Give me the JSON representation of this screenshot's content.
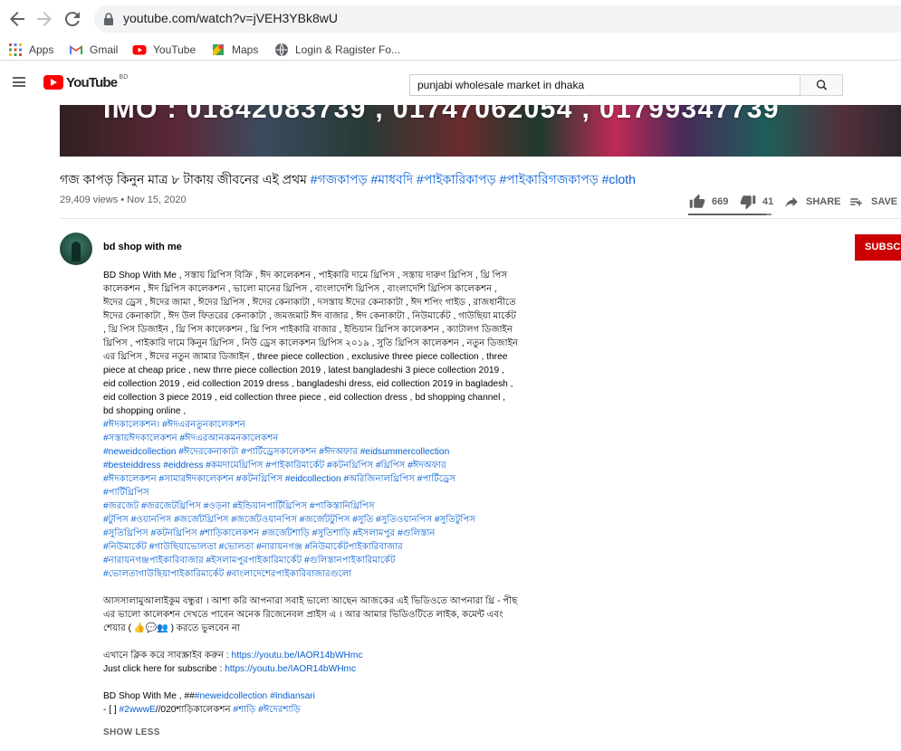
{
  "browser": {
    "url": "youtube.com/watch?v=jVEH3YBk8wU",
    "bookmarks": [
      {
        "label": "Apps",
        "icon": "apps-grid-icon"
      },
      {
        "label": "Gmail",
        "icon": "gmail-icon"
      },
      {
        "label": "YouTube",
        "icon": "youtube-icon"
      },
      {
        "label": "Maps",
        "icon": "maps-icon"
      },
      {
        "label": "Login & Ragister Fo...",
        "icon": "globe-icon"
      }
    ]
  },
  "youtube": {
    "logo_text": "YouTube",
    "country_code": "BD",
    "search_query": "punjabi wholesale market in dhaka"
  },
  "video": {
    "overlay_text": "IMO : 01842083739 , 01747062054 , 01799347739"
  },
  "meta": {
    "title_text": "গজ কাপড় কিনুন মাত্র ৮ টাকায় জীবনের এই প্রথম ",
    "title_tags": "#গজকাপড় #মাধবদি #পাইকারিকাপড় #পাইকারিগজকাপড় #cloth",
    "views": "29,409 views • Nov 15, 2020",
    "likes": "669",
    "dislikes": "41",
    "like_ratio": 0.94,
    "share_label": "SHARE",
    "save_label": "SAVE"
  },
  "channel": {
    "name": "bd shop with me",
    "subscribe_label": "SUBSCR"
  },
  "description": {
    "para1": "BD Shop With Me , সস্তায় থ্রিপিস বিক্রি , ঈদ কালেকশন , পাইকারি দামে থ্রিপিস , সস্তায় দারুণ থ্রিপিস , থ্রি পিস কালেকশন , ঈদ থ্রিপিস কালেকশন , ভালো মানের থ্রিপিস , বাংলাদেশি থ্রিপিস , বাংলাদেশি থ্রিপিস কালেকশন , ঈদের ড্রেস , ঈদের জামা , ঈদের থ্রিপিস , ঈদের কেনাকাটা , দসস্তায় ঈদের কেনাকাটা , ঈদ শপিং গাইড , রাজধানীতে ঈদের কেনাকাটা , ঈদ উল ফিতরের কেনাকাটা , জমজমাট ঈদ বাজার , ঈদ কেনাকাটা , নিউমার্কেট , গাউছিয়া মার্কেট , থ্রি পিস ডিজাইন , থ্রি পিস কালেকশন , থ্রি পিস পাইকারি বাজার , ইন্ডিয়ান থ্রিপিস কালেকশন , ক্যাটালগ ডিজাইন থ্রিপিস , পাইকারি দামে কিনুন থ্রিপিস , নিউ ড্রেস কালেকশন থ্রিপিস ২০১৯ , সুতি থ্রিপিস কালেকশন , নতুন ডিজাইন এর থ্রিপিস , ঈদের নতুন জামার ডিজাইন , three piece collection , exclusive three piece collection , three piece at cheap price , new thrre piece collection 2019 , latest bangladeshi 3 piece collection 2019 , eid collection 2019 , eid collection 2019 dress , bangladeshi dress, eid collection  2019 in bagladesh , eid collection 3 piece 2019 , eid collection three piece ,  eid collection dress , bd shopping channel , bd shopping online ,",
    "hashtags": [
      "#ঈদকালেকশন।  #ঈদএরনতুনকালেকশন",
      "#সস্তায়ঈদকালেকশন         #ঈদএরআনকমনকালেকশন",
      "#neweidcollection    #ঈদেরকেনাকাটা    #পার্টিড্রেসকালেকশন #ঈদঅফার #eidsummercollection",
      "#besteiddress #eiddress #কমদামেথ্রিপিস #পাইকারিমার্কেট #কটনথ্রিপিস #থ্রিপিস  #ঈদঅফার",
      "#ঈদকালেকশন #সামারঈদকালেকশন #কটনথ্রিপিস #eidcollection #অরিজিনালথ্রিপিস #পার্টিড্রেস",
      "#পার্টিথ্রিপিস",
      "#জরজেট #জরজেটথ্রিপিস #ওড়না  #ইন্ডিয়ানপার্টিথ্রিপিস #পাকিস্তানিথ্রিপিস",
      "#টুপিস #ওয়ানপিস #জর্জেটথ্রিপিস #জর্জেটওয়ানপিস #জর্জেটটুপিস #সুতি #সুতিওয়ানপিস #সুতিটুপিস",
      "#সুতিথ্রিপিস #কটনথ্রিপিস #শাড়িকালেকশন #জর্জেটশাড়ি #সুতিশাড়ি #ইসলামপুর #গুলিস্তান",
      "#নিউমার্কেট #গাউছিয়াভোলতা #ভোলতা #নারায়নগঞ্জ #নিউমার্কেটপাইকারিবাজার",
      "#নারায়নগঞ্জপাইকারিবাজার #ইসলামপুরপাইকারিমার্কেট #গুলিস্তানপাইকারিমার্কেট",
      "#ভোলতাগাউছিয়াপাইকারিমার্কেট  #বাংলাদেশেরপাইকারিবাজারগুলো"
    ],
    "para2": "আসসালামুআলাইকুম  বন্ধুরা । আশা করি আপনারা সবাই ভালো আছেন আজকের এই ভিডিওতে আপনারা থ্রি - পীছ এর ভালো কালেকশন দেখতে পাবেন অনেক রিজেনেবল প্রাইস এ । আর আমার ভিডিওটিতে লাইক, কমেন্ট এবং শেয়ার ( 👍💬👥 ) করতে ভুলবেন না",
    "subscribe_bn_prefix": "এখানে ক্লিক করে সাবস্ক্রাইব করুন : ",
    "subscribe_en_prefix": "Just click here for subscribe : ",
    "subscribe_link": "https://youtu.be/IAOR14bWHmc",
    "footer1_prefix": "BD Shop With Me , ##",
    "footer1_link1": "#neweidcollection",
    "footer1_link2": "#Indiansari",
    "footer2_prefix": "- [ ] ",
    "footer2_link1": "#2wwwE",
    "footer2_mid": "//020শাড়িকালেকশন ",
    "footer2_link2": "#শাড়ি",
    "footer2_link3": "#ঈদেরশাড়ি",
    "show_less": "SHOW LESS"
  },
  "colors": {
    "link": "#065fd4",
    "subscribe": "#cc0000",
    "brand": "#ff0000"
  }
}
